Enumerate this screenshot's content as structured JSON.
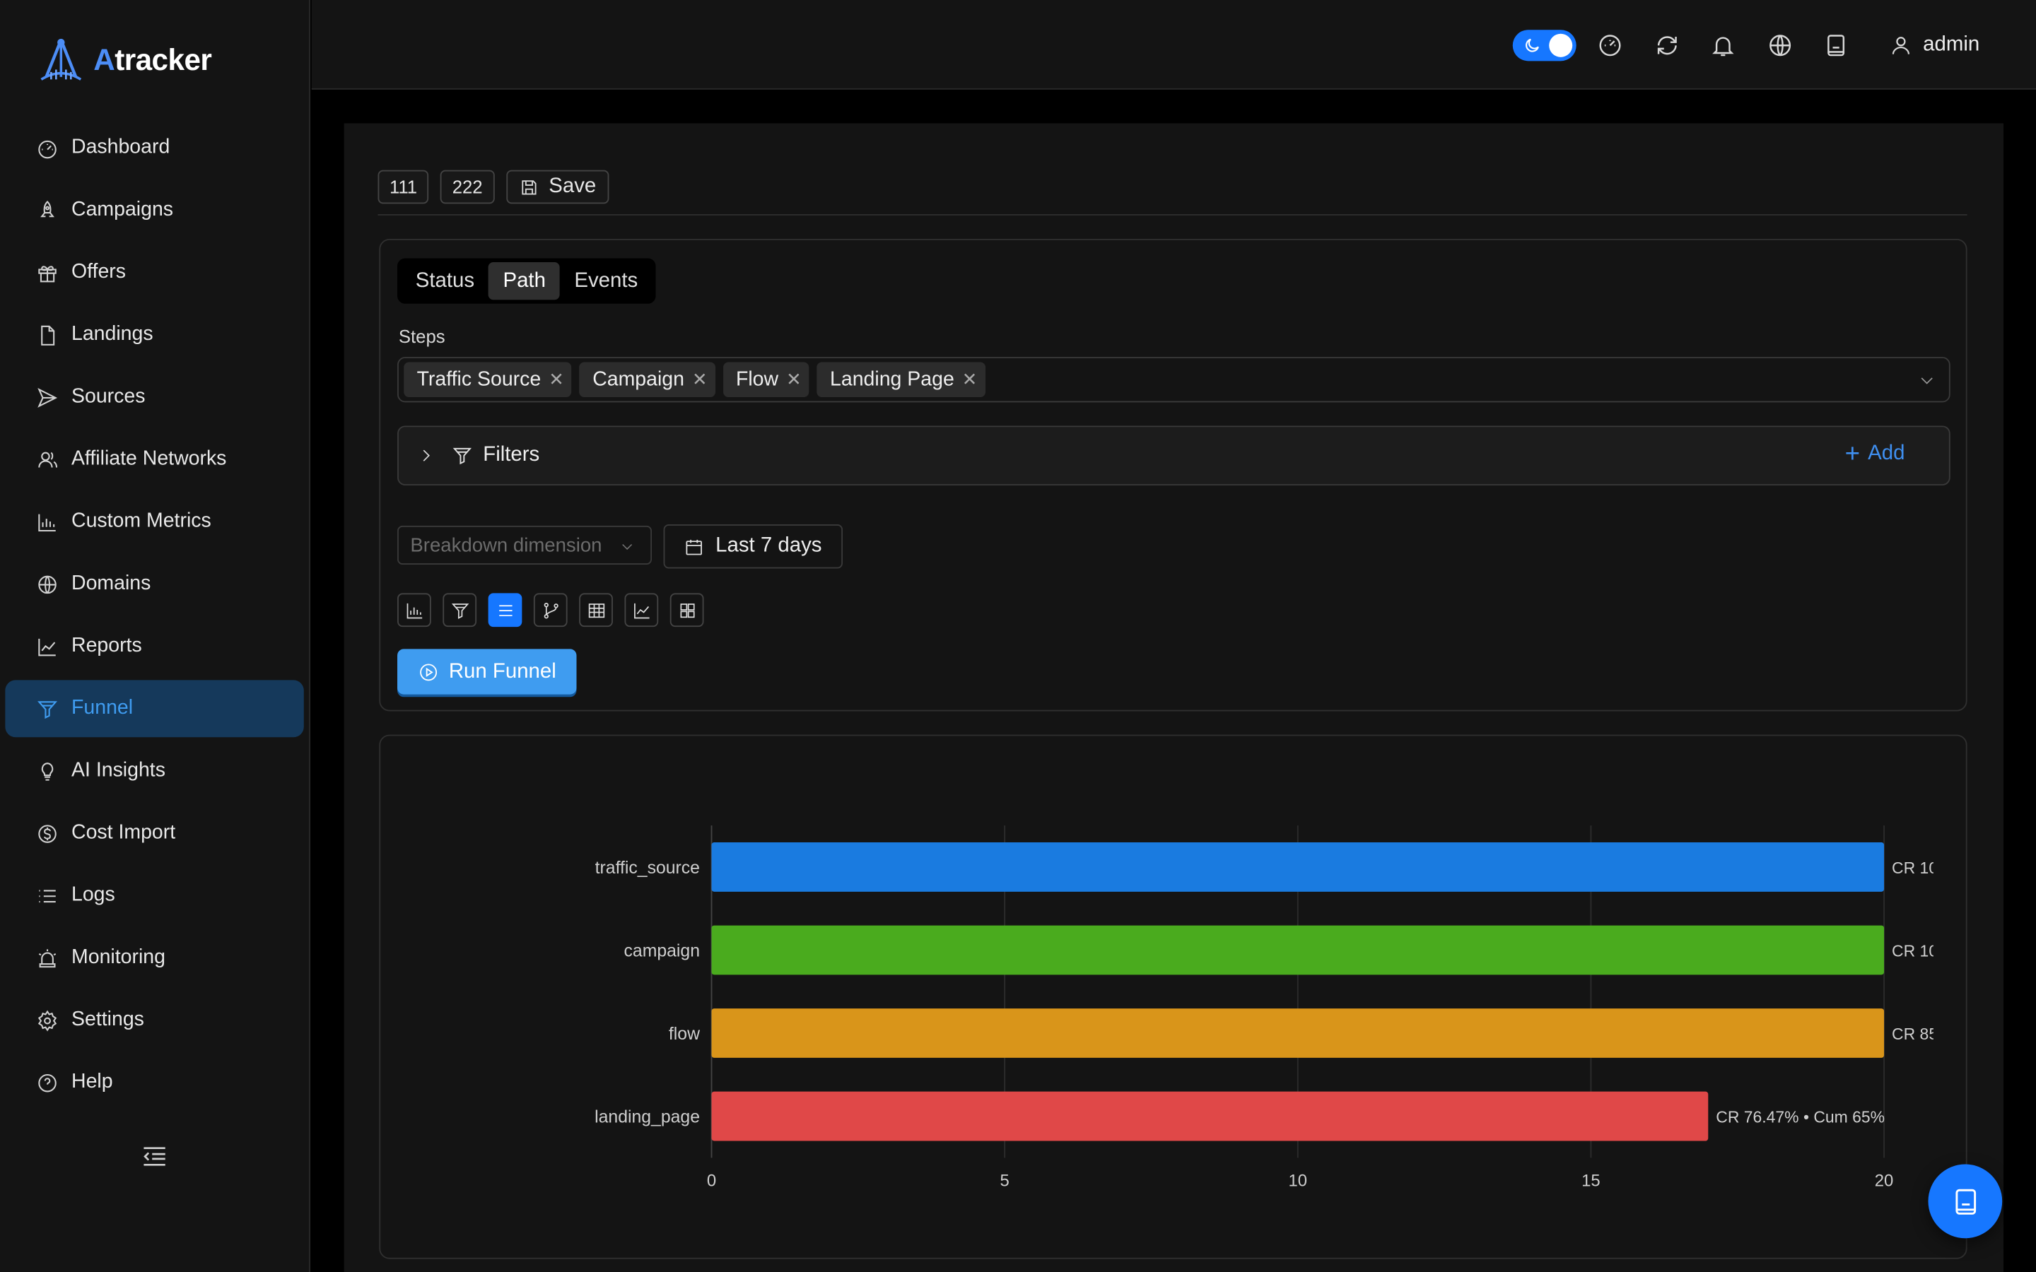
{
  "app": {
    "logo_prefix": "A",
    "logo_suffix": "tracker"
  },
  "sidebar": {
    "items": [
      {
        "label": "Dashboard",
        "icon": "dashboard-icon"
      },
      {
        "label": "Campaigns",
        "icon": "rocket-icon"
      },
      {
        "label": "Offers",
        "icon": "gift-icon"
      },
      {
        "label": "Landings",
        "icon": "file-icon"
      },
      {
        "label": "Sources",
        "icon": "send-icon"
      },
      {
        "label": "Affiliate Networks",
        "icon": "users-icon"
      },
      {
        "label": "Custom Metrics",
        "icon": "bar-chart-icon"
      },
      {
        "label": "Domains",
        "icon": "globe-icon"
      },
      {
        "label": "Reports",
        "icon": "line-chart-icon"
      },
      {
        "label": "Funnel",
        "icon": "funnel-icon",
        "active": true
      },
      {
        "label": "AI Insights",
        "icon": "bulb-icon"
      },
      {
        "label": "Cost Import",
        "icon": "dollar-icon"
      },
      {
        "label": "Logs",
        "icon": "list-icon"
      },
      {
        "label": "Monitoring",
        "icon": "alarm-icon"
      },
      {
        "label": "Settings",
        "icon": "gear-icon"
      },
      {
        "label": "Help",
        "icon": "question-icon"
      }
    ]
  },
  "header": {
    "user": "admin",
    "theme_dark": true
  },
  "toolbar": {
    "chip1": "111",
    "chip2": "222",
    "save_label": "Save"
  },
  "query": {
    "tabs": [
      {
        "label": "Status"
      },
      {
        "label": "Path",
        "active": true
      },
      {
        "label": "Events"
      }
    ],
    "steps_label": "Steps",
    "steps": [
      "Traffic Source",
      "Campaign",
      "Flow",
      "Landing Page"
    ],
    "filters_label": "Filters",
    "add_label": "Add",
    "breakdown_placeholder": "Breakdown dimension",
    "date_range": "Last 7 days",
    "run_label": "Run Funnel"
  },
  "colors": {
    "accent": "#1677ff",
    "active_nav_bg": "#15395b"
  },
  "chart_data": {
    "type": "bar",
    "orientation": "horizontal",
    "categories": [
      "traffic_source",
      "campaign",
      "flow",
      "landing_page"
    ],
    "values": [
      20,
      20,
      20,
      17
    ],
    "colors": [
      "#1a7be0",
      "#4aab1e",
      "#d9951a",
      "#e04848"
    ],
    "data_labels": [
      "CR 10",
      "CR 10",
      "CR 85",
      "CR 76.47% • Cum 65%"
    ],
    "xlim": [
      0,
      20
    ],
    "xticks": [
      0,
      5,
      10,
      15,
      20
    ],
    "grid": true
  }
}
